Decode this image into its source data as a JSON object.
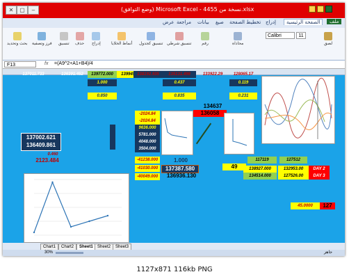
{
  "window": {
    "title": "(وضع التوافق) Microsoft Excel - نسخة من 4455.xlsx",
    "buttons": [
      "✕",
      "▢",
      "–"
    ]
  },
  "ribbon_tabs": [
    "ملف",
    "الصفحة الرئيسية",
    "إدراج",
    "تخطيط الصفحة",
    "صيغ",
    "بيانات",
    "مراجعة",
    "عرض"
  ],
  "ribbon": {
    "font_name": "Calibri",
    "font_size": "11",
    "groups": [
      "لصق",
      "محاذاة",
      "رقم",
      "تنسيق شرطي",
      "تنسيق كجدول",
      "أنماط الخلايا",
      "إدراج",
      "حذف",
      "تنسيق",
      "فرز وتصفية",
      "بحث وتحديد"
    ]
  },
  "formula_bar": {
    "name_box": "F13",
    "fx": "fx",
    "formula": "=(A9^2+A1+B4)/4"
  },
  "cells": {
    "r1": [
      "137011.733",
      "136391.452",
      "139772.000",
      "139949.000",
      "138192.935",
      "135131.498",
      "133922.29",
      "128065.17"
    ],
    "r2": [
      "1.000",
      "0.437",
      "0.119"
    ],
    "r3": [
      "0.850",
      "0.835",
      "0.231"
    ],
    "mid_label": "134637",
    "mid_red": "136058",
    "left_box": [
      "137002.621",
      "136409.861"
    ],
    "red_small": "0.460",
    "red_value": "2123.484",
    "col_small": [
      "-2024.84",
      "-2024.84",
      "9636.000",
      "5781.000",
      "4048.000",
      "3504.000"
    ],
    "col_neg": [
      "-41238.000",
      "-41030.000",
      "-40049.000"
    ],
    "center_vals": [
      "1.000",
      "137387.580",
      "136936.130"
    ],
    "right_top": [
      "117119",
      "127512"
    ],
    "right_rows": [
      [
        "138927.000",
        "132953.00",
        "DAY 2"
      ],
      [
        "134514.000",
        "127526.00",
        "DAY 3"
      ]
    ],
    "yellow_49": "49",
    "bottom_right": [
      "45.0000",
      "127"
    ]
  },
  "charts": {
    "bottom_left": {
      "type": "line",
      "x": [
        1,
        2,
        3,
        4,
        5
      ],
      "y": [
        5,
        95,
        15,
        25,
        35
      ],
      "ylim": [
        0,
        100
      ]
    }
  },
  "sheet_tabs": [
    "Chart1",
    "Chart2",
    "Sheet1",
    "Sheet2",
    "Sheet3"
  ],
  "active_sheet": "Sheet1",
  "status": {
    "ready": "جاهز",
    "zoom": "30%"
  },
  "caption": "1127x871  116kb  PNG",
  "colors": {
    "grid_bg": "#1ba3e8",
    "title_red": "#e00000",
    "yellow": "#ffff00",
    "green": "#92d050",
    "red": "#ff0000",
    "navy": "#17375e"
  }
}
